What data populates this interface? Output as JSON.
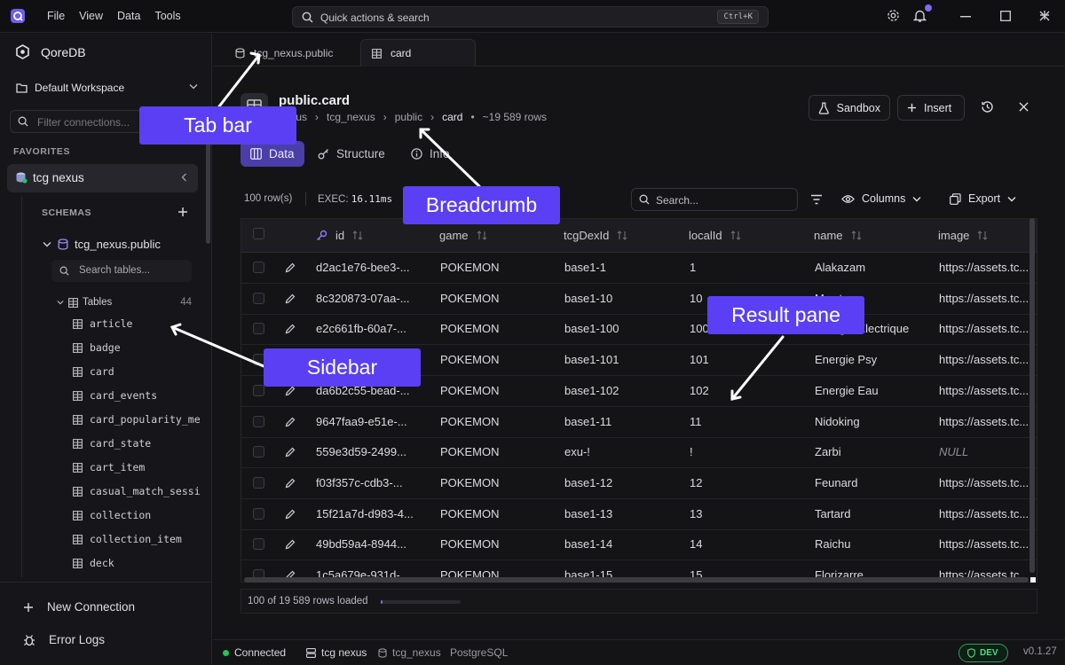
{
  "menu": [
    "File",
    "View",
    "Data",
    "Tools"
  ],
  "search": {
    "placeholder": "Quick actions & search",
    "shortcut": "Ctrl+K"
  },
  "sidebar": {
    "brand": "QoreDB",
    "workspace": "Default Workspace",
    "filter_placeholder": "Filter connections...",
    "favorites_label": "FAVORITES",
    "favorite": "tcg nexus",
    "schemas_label": "SCHEMAS",
    "schema": "tcg_nexus.public",
    "table_search_placeholder": "Search tables...",
    "tables_label": "Tables",
    "tables_count": "44",
    "tables": [
      "article",
      "badge",
      "card",
      "card_events",
      "card_popularity_me",
      "card_state",
      "cart_item",
      "casual_match_sessi",
      "collection",
      "collection_item",
      "deck"
    ],
    "new_connection": "New Connection",
    "error_logs": "Error Logs"
  },
  "tabs": [
    {
      "label": "tcg_nexus.public",
      "icon": "database-icon"
    },
    {
      "label": "card",
      "icon": "table-icon"
    }
  ],
  "header": {
    "title": "public.card",
    "breadcrumb": [
      "nexus",
      "tcg_nexus",
      "public",
      "card"
    ],
    "row_estimate": "~19 589 rows",
    "sandbox": "Sandbox",
    "insert": "Insert"
  },
  "view_tabs": [
    "Data",
    "Structure",
    "Info"
  ],
  "toolbar": {
    "rows": "100 row(s)",
    "exec_label": "EXEC:",
    "exec_value": "16.11ms",
    "search_placeholder": "Search...",
    "columns": "Columns",
    "export": "Export"
  },
  "grid": {
    "columns": [
      "id",
      "game",
      "tcgDexId",
      "localId",
      "name",
      "image"
    ],
    "rows": [
      [
        "d2ac1e76-bee3-...",
        "POKEMON",
        "base1-1",
        "1",
        "Alakazam",
        "https://assets.tc..."
      ],
      [
        "8c320873-07aa-...",
        "POKEMON",
        "base1-10",
        "10",
        "Mewtwo",
        "https://assets.tc..."
      ],
      [
        "e2c661fb-60a7-...",
        "POKEMON",
        "base1-100",
        "100",
        "Énergie Électrique",
        "https://assets.tc..."
      ],
      [
        "",
        "POKEMON",
        "base1-101",
        "101",
        "Energie Psy",
        "https://assets.tc..."
      ],
      [
        "da6b2c55-bead-...",
        "POKEMON",
        "base1-102",
        "102",
        "Energie Eau",
        "https://assets.tc..."
      ],
      [
        "9647faa9-e51e-...",
        "POKEMON",
        "base1-11",
        "11",
        "Nidoking",
        "https://assets.tc..."
      ],
      [
        "559e3d59-2499...",
        "POKEMON",
        "exu-!",
        "!",
        "Zarbi",
        "NULL"
      ],
      [
        "f03f357c-cdb3-...",
        "POKEMON",
        "base1-12",
        "12",
        "Feunard",
        "https://assets.tc..."
      ],
      [
        "15f21a7d-d983-4...",
        "POKEMON",
        "base1-13",
        "13",
        "Tartard",
        "https://assets.tc..."
      ],
      [
        "49bd59a4-8944...",
        "POKEMON",
        "base1-14",
        "14",
        "Raichu",
        "https://assets.tc..."
      ],
      [
        "1c5a679e-931d-...",
        "POKEMON",
        "base1-15",
        "15",
        "Florizarre",
        "https://assets.tc..."
      ]
    ]
  },
  "footer": {
    "loaded": "100 of 19 589 rows loaded",
    "progress": 0.02
  },
  "status": {
    "connected": "Connected",
    "connection": "tcg nexus",
    "schema": "tcg_nexus",
    "driver": "PostgreSQL",
    "env": "DEV",
    "version": "v0.1.27"
  },
  "annotations": {
    "tab_bar": "Tab bar",
    "breadcrumb": "Breadcrumb",
    "sidebar": "Sidebar",
    "result_pane": "Result pane"
  },
  "colors": {
    "accent": "#5b3ff5",
    "active_tab": "#4a3fa8",
    "connected": "#22c55e"
  }
}
